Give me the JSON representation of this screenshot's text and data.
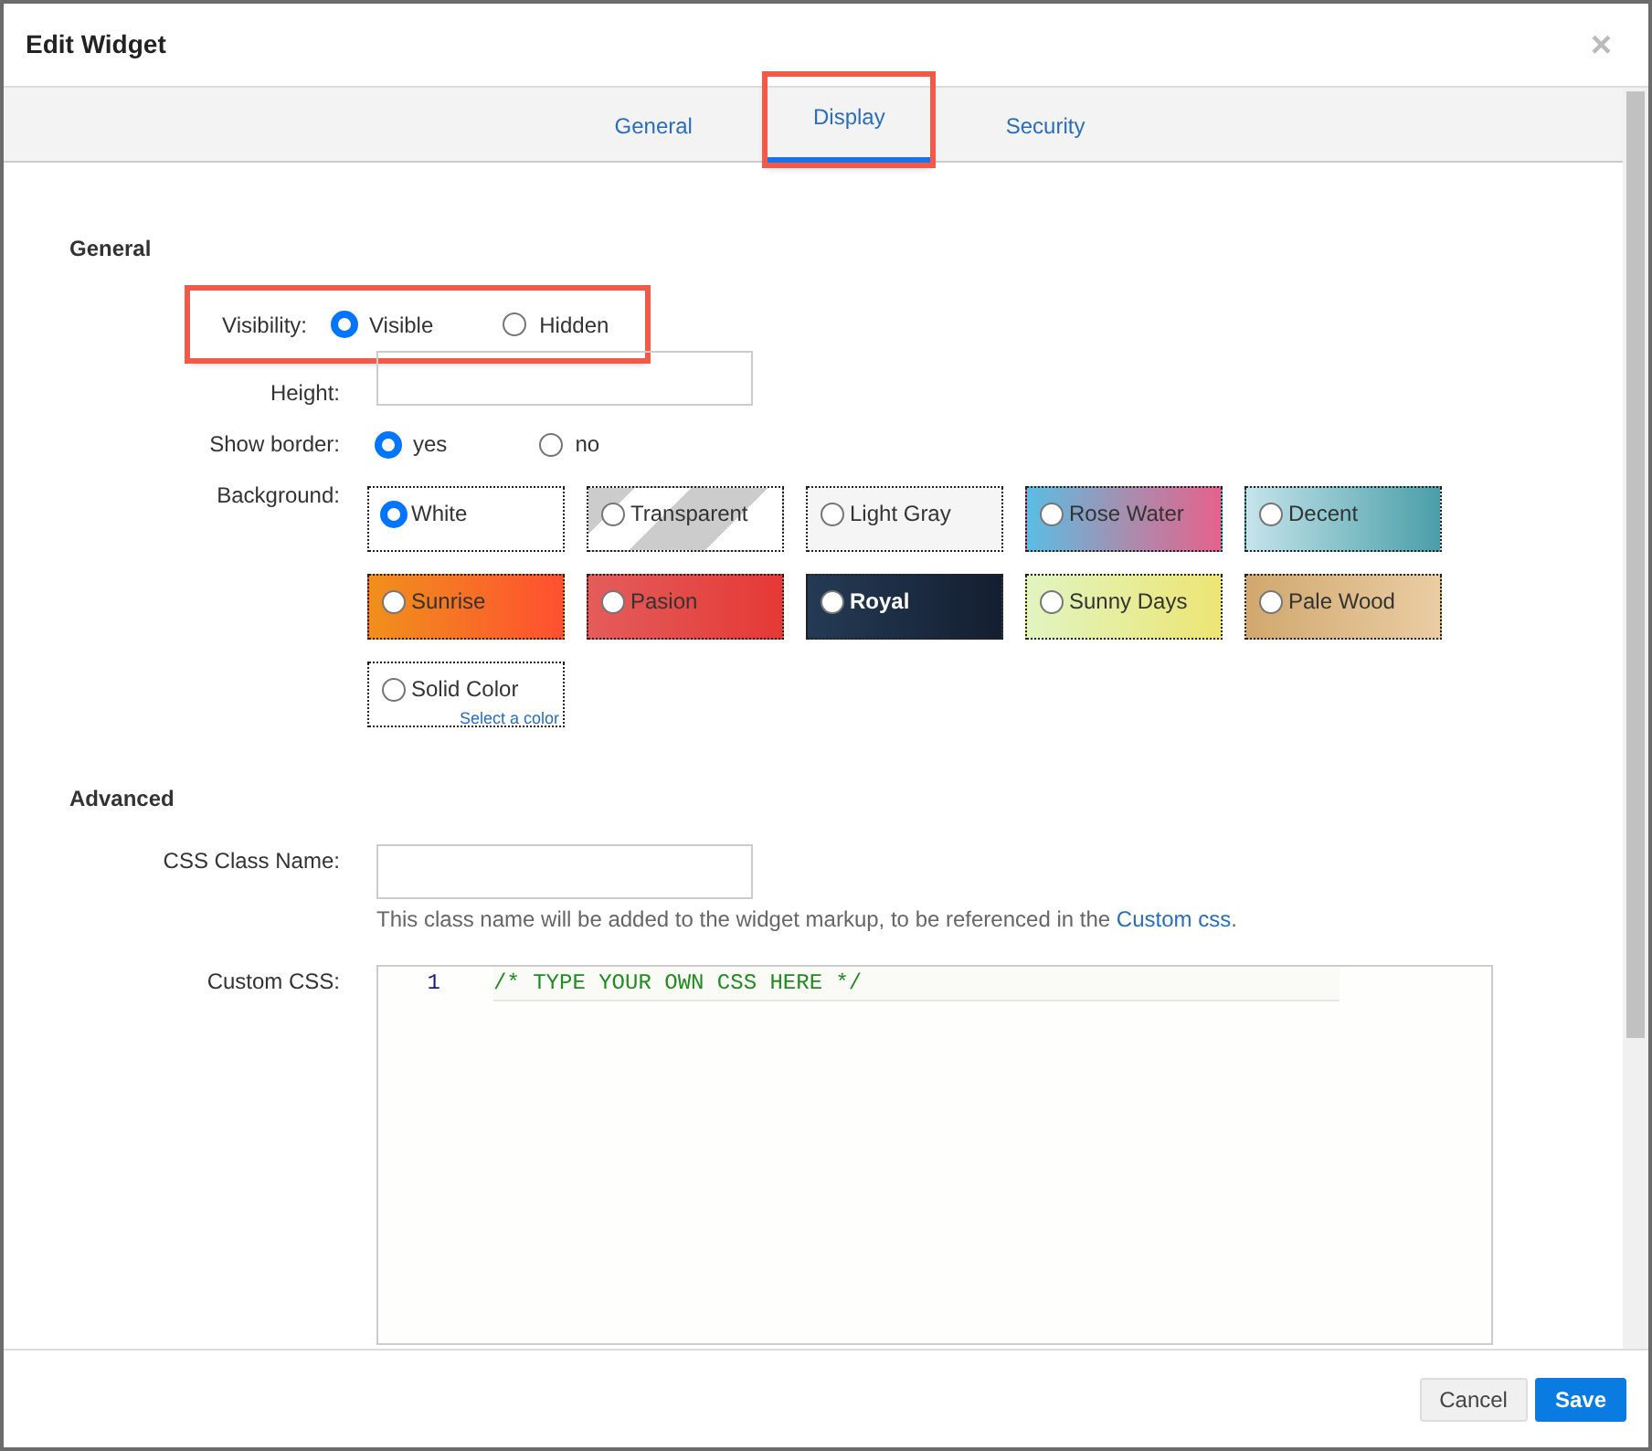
{
  "dialog": {
    "title": "Edit Widget",
    "close": "×"
  },
  "tabs": [
    {
      "label": "General",
      "selected": false,
      "highlighted": false
    },
    {
      "label": "Display",
      "selected": true,
      "highlighted": true
    },
    {
      "label": "Security",
      "selected": false,
      "highlighted": false
    }
  ],
  "general": {
    "heading": "General",
    "visibility": {
      "label": "Visibility:",
      "highlighted": true,
      "options": [
        {
          "label": "Visible",
          "selected": true
        },
        {
          "label": "Hidden",
          "selected": false
        }
      ]
    },
    "height": {
      "label": "Height:"
    },
    "show_border": {
      "label": "Show border:",
      "options": [
        {
          "label": "yes",
          "selected": true
        },
        {
          "label": "no",
          "selected": false
        }
      ]
    },
    "background": {
      "label": "Background:",
      "options": [
        {
          "label": "White",
          "kind": "white",
          "selected": true
        },
        {
          "label": "Transparent",
          "kind": "transparent",
          "selected": false
        },
        {
          "label": "Light Gray",
          "kind": "lightgray",
          "selected": false
        },
        {
          "label": "Rose Water",
          "kind": "rosewater",
          "selected": false
        },
        {
          "label": "Decent",
          "kind": "decent",
          "selected": false
        },
        {
          "label": "Sunrise",
          "kind": "sunrise",
          "selected": false
        },
        {
          "label": "Pasion",
          "kind": "pasion",
          "selected": false
        },
        {
          "label": "Royal",
          "kind": "royal",
          "selected": false
        },
        {
          "label": "Sunny Days",
          "kind": "sunny",
          "selected": false
        },
        {
          "label": "Pale Wood",
          "kind": "palewood",
          "selected": false
        },
        {
          "label": "Solid Color",
          "kind": "solid",
          "selected": false,
          "link": "Select a color"
        }
      ]
    }
  },
  "advanced": {
    "heading": "Advanced",
    "css_class": {
      "label": "CSS Class Name:",
      "help": "This class name will be added to the widget markup, to be referenced in the",
      "help_link": "Custom css",
      "help_end": "."
    },
    "custom_css": {
      "label": "Custom CSS:",
      "lines": [
        {
          "number": "1",
          "code": "/* TYPE YOUR OWN CSS HERE */"
        }
      ]
    }
  },
  "footer": {
    "buttons": [
      {
        "label": "Cancel",
        "kind": "secondary"
      },
      {
        "label": "Save",
        "kind": "primary"
      }
    ]
  }
}
